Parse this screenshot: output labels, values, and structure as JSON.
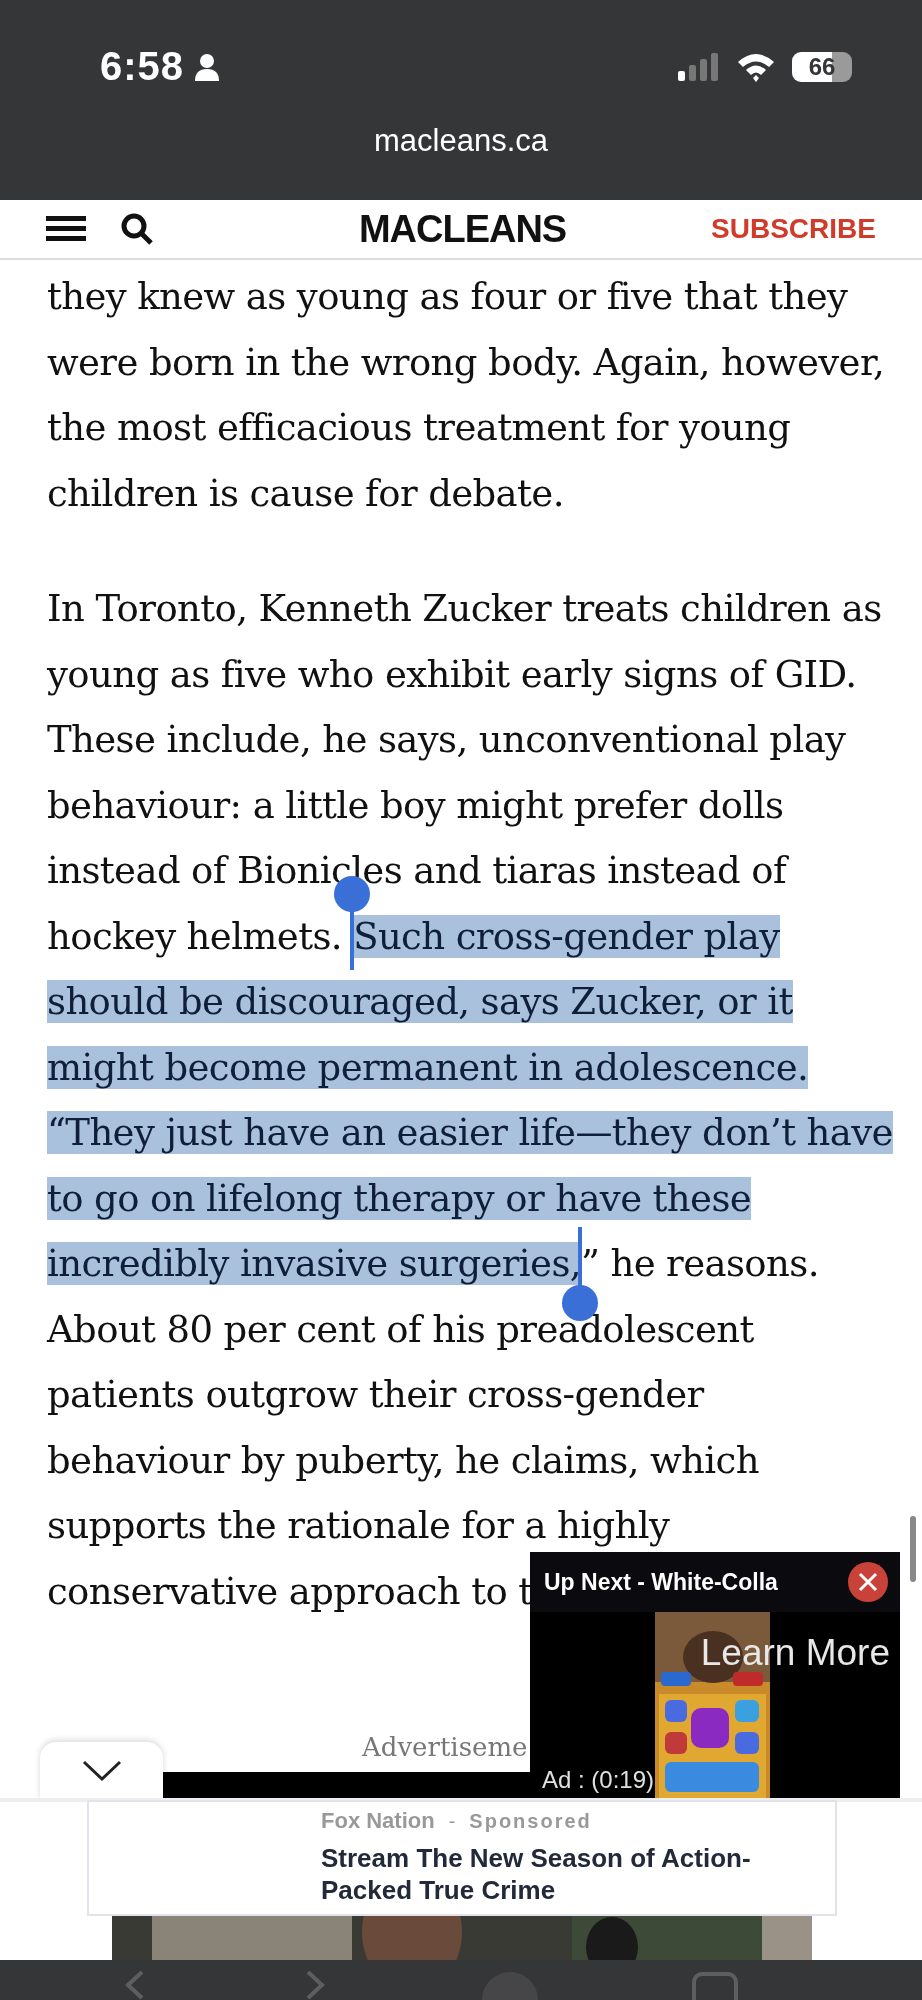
{
  "status_bar": {
    "time": "6:58",
    "battery": "66"
  },
  "address_bar": {
    "url": "macleans.ca"
  },
  "site_header": {
    "logo": "MACLEANS",
    "subscribe": "SUBSCRIBE"
  },
  "article": {
    "paragraphs": [
      {
        "segments": [
          {
            "text": "they knew as young as four or five that they were born in the wrong body. Again, however, the most efficacious treatment for young children is cause for debate.",
            "selected": false
          }
        ]
      },
      {
        "segments": [
          {
            "text": "In Toronto, Kenneth Zucker treats children as young as five who exhibit early signs of GID. These include, he says, unconventional play behaviour: a little boy might prefer dolls instead of Bionicles and tiaras instead of hockey helmets. ",
            "selected": false
          },
          {
            "text": "Such cross-gender play should be discouraged, says Zucker, or it might become permanent in adolescence. “They just have an easier life—they don’t have to go on lifelong therapy or have these incredibly invasive surgeries,",
            "selected": true
          },
          {
            "text": "” he reasons. About 80 per cent of his preadolescent patients outgrow their cross-gender behaviour by puberty, he claims, which supports the rationale for a highly conservative approach to t",
            "selected": false
          }
        ]
      }
    ]
  },
  "ad_label": "Advertiseme",
  "video_player": {
    "title": "Up Next - White-Colla",
    "cta": "Learn More",
    "ad_timer": "Ad : (0:19)"
  },
  "sponsored_card": {
    "source": "Fox Nation",
    "separator": "-",
    "label": "Sponsored",
    "headline": "Stream The New Season of Action-Packed True Crime"
  }
}
